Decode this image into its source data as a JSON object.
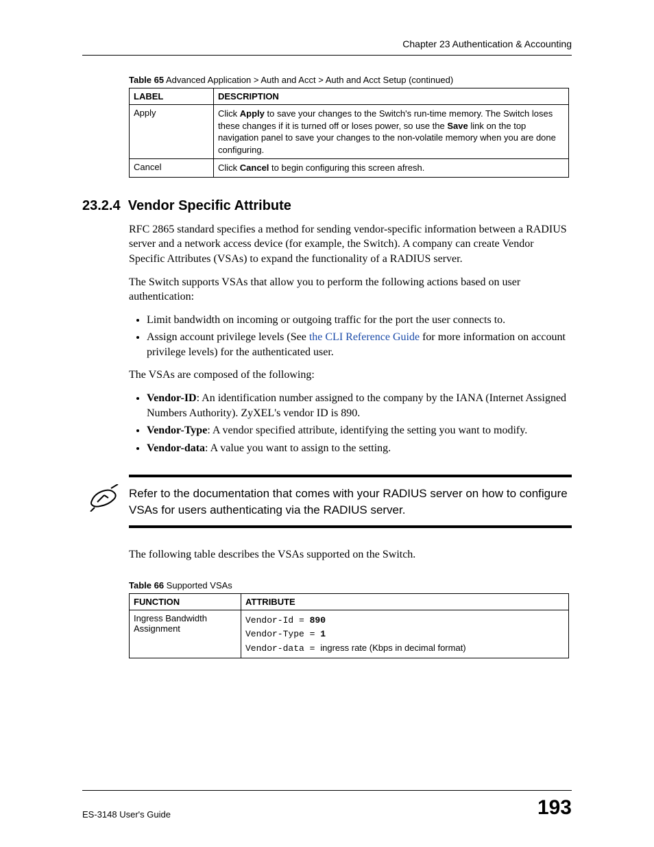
{
  "running_header": "Chapter 23 Authentication & Accounting",
  "table65": {
    "caption_bold": "Table 65",
    "caption_rest": "   Advanced Application > Auth and Acct > Auth and Acct Setup  (continued)",
    "headers": {
      "label": "LABEL",
      "description": "DESCRIPTION"
    },
    "rows": [
      {
        "label": "Apply",
        "desc_pre": "Click ",
        "desc_b1": "Apply",
        "desc_mid": " to save your changes to the Switch's run-time memory. The Switch loses these changes if it is turned off or loses power, so use the ",
        "desc_b2": "Save",
        "desc_post": " link on the top navigation panel to save your changes to the non-volatile memory when you are done configuring."
      },
      {
        "label": "Cancel",
        "desc_pre": "Click ",
        "desc_b1": "Cancel",
        "desc_post": " to begin configuring this screen afresh."
      }
    ]
  },
  "section": {
    "number": "23.2.4",
    "title": "Vendor Specific Attribute",
    "p1": "RFC 2865 standard specifies a method for sending vendor-specific information between a RADIUS server and a network access device (for example, the Switch). A company can create Vendor Specific Attributes (VSAs) to expand the functionality of a RADIUS server.",
    "p2": "The Switch supports VSAs that allow you to perform the following actions based on user authentication:",
    "bullets1": [
      "Limit bandwidth on incoming or outgoing traffic for the port the user connects to."
    ],
    "bullet2_pre": "Assign account privilege levels (See ",
    "bullet2_link": "the CLI Reference Guide",
    "bullet2_post": " for more information on account privilege levels) for the authenticated user.",
    "p3": "The VSAs are composed of the following:",
    "defs": [
      {
        "term": "Vendor-ID",
        "desc": ": An identification number assigned to the company by the IANA (Internet Assigned Numbers Authority). ZyXEL's vendor ID is 890."
      },
      {
        "term": "Vendor-Type",
        "desc": ": A vendor specified attribute, identifying the setting you want to modify."
      },
      {
        "term": "Vendor-data",
        "desc": ": A value you want to assign to the setting."
      }
    ],
    "note": "Refer to the documentation that comes with your RADIUS server on how to configure VSAs for users authenticating via the RADIUS server.",
    "p4": "The following table describes the VSAs supported on the Switch."
  },
  "table66": {
    "caption_bold": "Table 66",
    "caption_rest": "   Supported VSAs",
    "headers": {
      "function": "FUNCTION",
      "attribute": "ATTRIBUTE"
    },
    "row": {
      "function": "Ingress Bandwidth Assignment",
      "l1_a": "Vendor-Id = ",
      "l1_b": "890",
      "l2_a": "Vendor-Type = ",
      "l2_b": "1",
      "l3_a": "Vendor-data = ",
      "l3_b": "ingress rate (Kbps in decimal format)"
    }
  },
  "footer": {
    "guide": "ES-3148 User's Guide",
    "page": "193"
  }
}
